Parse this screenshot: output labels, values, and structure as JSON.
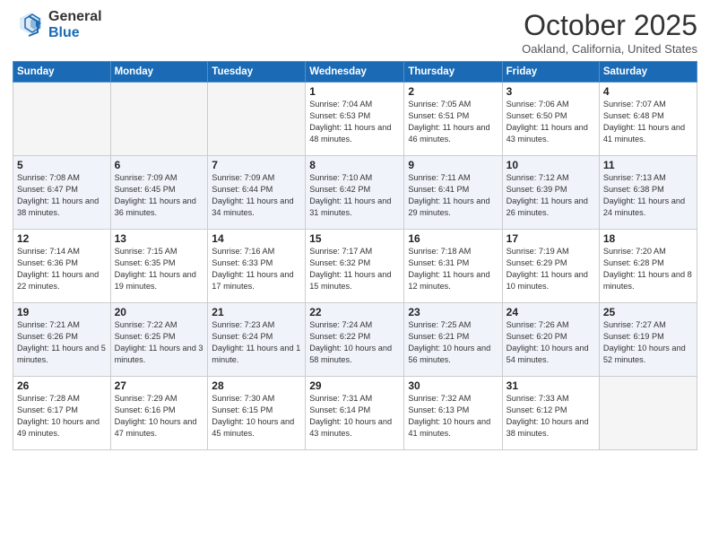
{
  "logo": {
    "general": "General",
    "blue": "Blue"
  },
  "title": "October 2025",
  "location": "Oakland, California, United States",
  "days_of_week": [
    "Sunday",
    "Monday",
    "Tuesday",
    "Wednesday",
    "Thursday",
    "Friday",
    "Saturday"
  ],
  "weeks": [
    [
      {
        "day": "",
        "info": ""
      },
      {
        "day": "",
        "info": ""
      },
      {
        "day": "",
        "info": ""
      },
      {
        "day": "1",
        "info": "Sunrise: 7:04 AM\nSunset: 6:53 PM\nDaylight: 11 hours\nand 48 minutes."
      },
      {
        "day": "2",
        "info": "Sunrise: 7:05 AM\nSunset: 6:51 PM\nDaylight: 11 hours\nand 46 minutes."
      },
      {
        "day": "3",
        "info": "Sunrise: 7:06 AM\nSunset: 6:50 PM\nDaylight: 11 hours\nand 43 minutes."
      },
      {
        "day": "4",
        "info": "Sunrise: 7:07 AM\nSunset: 6:48 PM\nDaylight: 11 hours\nand 41 minutes."
      }
    ],
    [
      {
        "day": "5",
        "info": "Sunrise: 7:08 AM\nSunset: 6:47 PM\nDaylight: 11 hours\nand 38 minutes."
      },
      {
        "day": "6",
        "info": "Sunrise: 7:09 AM\nSunset: 6:45 PM\nDaylight: 11 hours\nand 36 minutes."
      },
      {
        "day": "7",
        "info": "Sunrise: 7:09 AM\nSunset: 6:44 PM\nDaylight: 11 hours\nand 34 minutes."
      },
      {
        "day": "8",
        "info": "Sunrise: 7:10 AM\nSunset: 6:42 PM\nDaylight: 11 hours\nand 31 minutes."
      },
      {
        "day": "9",
        "info": "Sunrise: 7:11 AM\nSunset: 6:41 PM\nDaylight: 11 hours\nand 29 minutes."
      },
      {
        "day": "10",
        "info": "Sunrise: 7:12 AM\nSunset: 6:39 PM\nDaylight: 11 hours\nand 26 minutes."
      },
      {
        "day": "11",
        "info": "Sunrise: 7:13 AM\nSunset: 6:38 PM\nDaylight: 11 hours\nand 24 minutes."
      }
    ],
    [
      {
        "day": "12",
        "info": "Sunrise: 7:14 AM\nSunset: 6:36 PM\nDaylight: 11 hours\nand 22 minutes."
      },
      {
        "day": "13",
        "info": "Sunrise: 7:15 AM\nSunset: 6:35 PM\nDaylight: 11 hours\nand 19 minutes."
      },
      {
        "day": "14",
        "info": "Sunrise: 7:16 AM\nSunset: 6:33 PM\nDaylight: 11 hours\nand 17 minutes."
      },
      {
        "day": "15",
        "info": "Sunrise: 7:17 AM\nSunset: 6:32 PM\nDaylight: 11 hours\nand 15 minutes."
      },
      {
        "day": "16",
        "info": "Sunrise: 7:18 AM\nSunset: 6:31 PM\nDaylight: 11 hours\nand 12 minutes."
      },
      {
        "day": "17",
        "info": "Sunrise: 7:19 AM\nSunset: 6:29 PM\nDaylight: 11 hours\nand 10 minutes."
      },
      {
        "day": "18",
        "info": "Sunrise: 7:20 AM\nSunset: 6:28 PM\nDaylight: 11 hours\nand 8 minutes."
      }
    ],
    [
      {
        "day": "19",
        "info": "Sunrise: 7:21 AM\nSunset: 6:26 PM\nDaylight: 11 hours\nand 5 minutes."
      },
      {
        "day": "20",
        "info": "Sunrise: 7:22 AM\nSunset: 6:25 PM\nDaylight: 11 hours\nand 3 minutes."
      },
      {
        "day": "21",
        "info": "Sunrise: 7:23 AM\nSunset: 6:24 PM\nDaylight: 11 hours\nand 1 minute."
      },
      {
        "day": "22",
        "info": "Sunrise: 7:24 AM\nSunset: 6:22 PM\nDaylight: 10 hours\nand 58 minutes."
      },
      {
        "day": "23",
        "info": "Sunrise: 7:25 AM\nSunset: 6:21 PM\nDaylight: 10 hours\nand 56 minutes."
      },
      {
        "day": "24",
        "info": "Sunrise: 7:26 AM\nSunset: 6:20 PM\nDaylight: 10 hours\nand 54 minutes."
      },
      {
        "day": "25",
        "info": "Sunrise: 7:27 AM\nSunset: 6:19 PM\nDaylight: 10 hours\nand 52 minutes."
      }
    ],
    [
      {
        "day": "26",
        "info": "Sunrise: 7:28 AM\nSunset: 6:17 PM\nDaylight: 10 hours\nand 49 minutes."
      },
      {
        "day": "27",
        "info": "Sunrise: 7:29 AM\nSunset: 6:16 PM\nDaylight: 10 hours\nand 47 minutes."
      },
      {
        "day": "28",
        "info": "Sunrise: 7:30 AM\nSunset: 6:15 PM\nDaylight: 10 hours\nand 45 minutes."
      },
      {
        "day": "29",
        "info": "Sunrise: 7:31 AM\nSunset: 6:14 PM\nDaylight: 10 hours\nand 43 minutes."
      },
      {
        "day": "30",
        "info": "Sunrise: 7:32 AM\nSunset: 6:13 PM\nDaylight: 10 hours\nand 41 minutes."
      },
      {
        "day": "31",
        "info": "Sunrise: 7:33 AM\nSunset: 6:12 PM\nDaylight: 10 hours\nand 38 minutes."
      },
      {
        "day": "",
        "info": ""
      }
    ]
  ]
}
